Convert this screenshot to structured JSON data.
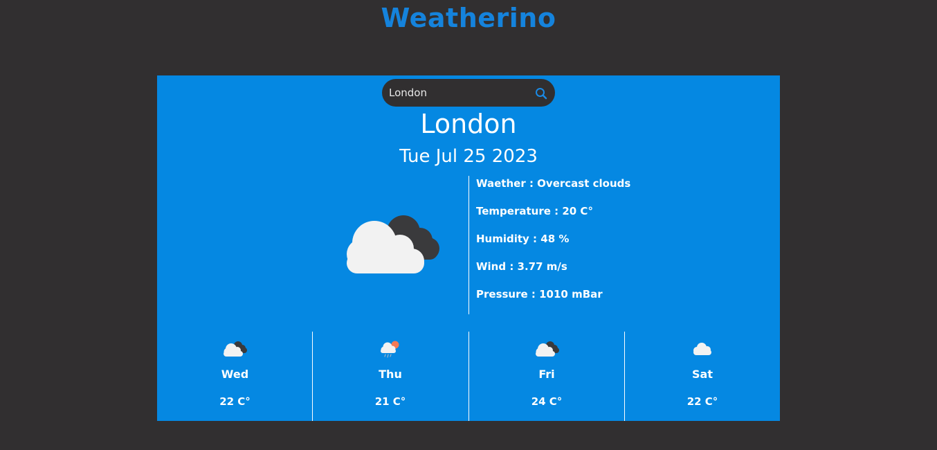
{
  "app": {
    "title": "Weatherino"
  },
  "search": {
    "value": "London",
    "icon": "search-icon"
  },
  "current": {
    "city": "London",
    "date": "Tue Jul 25 2023",
    "icon": "overcast-clouds-icon",
    "details": [
      {
        "label": "Waether : Overcast clouds"
      },
      {
        "label": "Temperature : 20 C°"
      },
      {
        "label": "Humidity : 48 %"
      },
      {
        "label": "Wind : 3.77 m/s"
      },
      {
        "label": "Pressure : 1010 mBar"
      }
    ]
  },
  "forecast": [
    {
      "day": "Wed",
      "temp": "22 C°",
      "icon": "overcast-clouds-icon"
    },
    {
      "day": "Thu",
      "temp": "21 C°",
      "icon": "sun-rain-icon"
    },
    {
      "day": "Fri",
      "temp": "24 C°",
      "icon": "overcast-clouds-icon"
    },
    {
      "day": "Sat",
      "temp": "22 C°",
      "icon": "cloud-icon"
    }
  ],
  "colors": {
    "background": "#312f30",
    "card": "#0588e2",
    "accent": "#1583dc",
    "text": "#ffffff"
  }
}
